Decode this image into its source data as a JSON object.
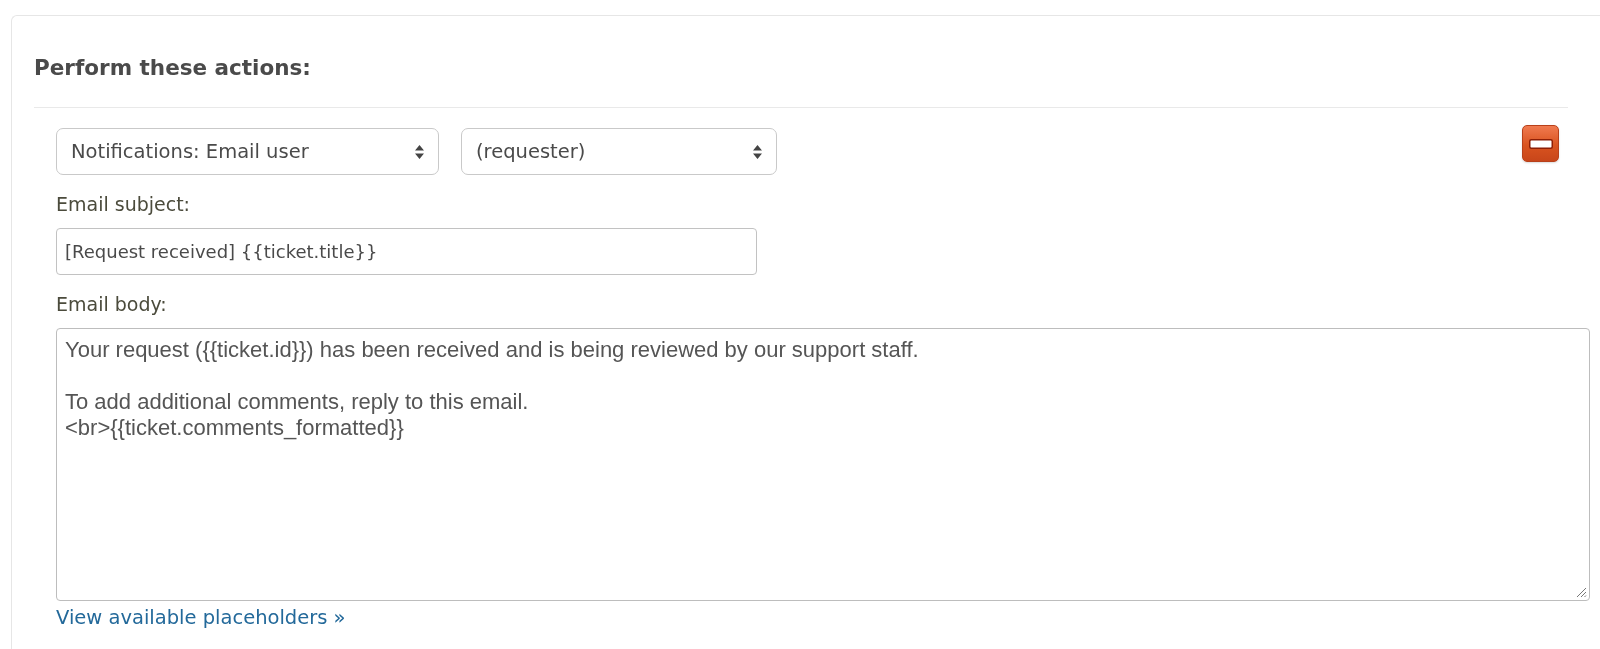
{
  "section": {
    "title": "Perform these actions:"
  },
  "action": {
    "selects": [
      {
        "value": "Notifications: Email user",
        "kind": "wide"
      },
      {
        "value": "(requester)",
        "kind": "narrow"
      }
    ],
    "fields": [
      {
        "kind": "input",
        "label": "Email subject:",
        "value": "[Request received] {{ticket.title}}"
      },
      {
        "kind": "textarea",
        "label": "Email body:",
        "value": "Your request ({{ticket.id}}) has been received and is being reviewed by our support staff.\n\nTo add additional comments, reply to this email.\n<br>{{ticket.comments_formatted}}"
      }
    ],
    "link": "View available placeholders »"
  }
}
